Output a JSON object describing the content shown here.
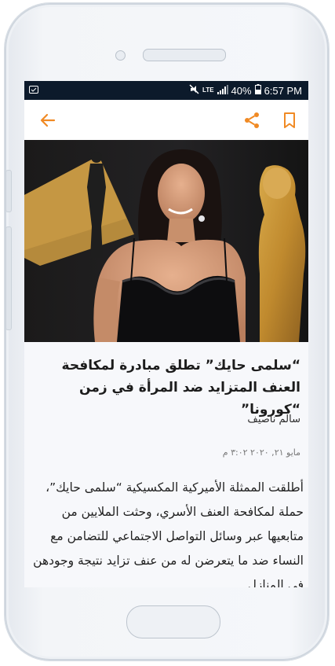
{
  "status_bar": {
    "battery": "40%",
    "time": "6:57 PM",
    "network": "LTE"
  },
  "app_bar": {
    "back_icon": "arrow-back-icon",
    "share_icon": "share-icon",
    "bookmark_icon": "bookmark-icon",
    "accent_color": "#f08a24"
  },
  "article": {
    "title": "“سلمى حايك” تطلق مبادرة لمكافحة العنف المتزايد ضد المرأة في زمن “كورونا”",
    "author": "سالم ناصيف",
    "date": "مايو ٢١, ٢٠٢٠ ٣:٠٢ م",
    "body": "أطلقت الممثلة الأميركية المكسيكية “سلمى حايك”، حملة لمكافحة العنف الأسري، وحثت الملايين من متابعيها عبر وسائل التواصل الاجتماعي للتضامن مع النساء ضد ما يتعرضن له من عنف تزايد نتيجة وجودهن في المنازل"
  }
}
